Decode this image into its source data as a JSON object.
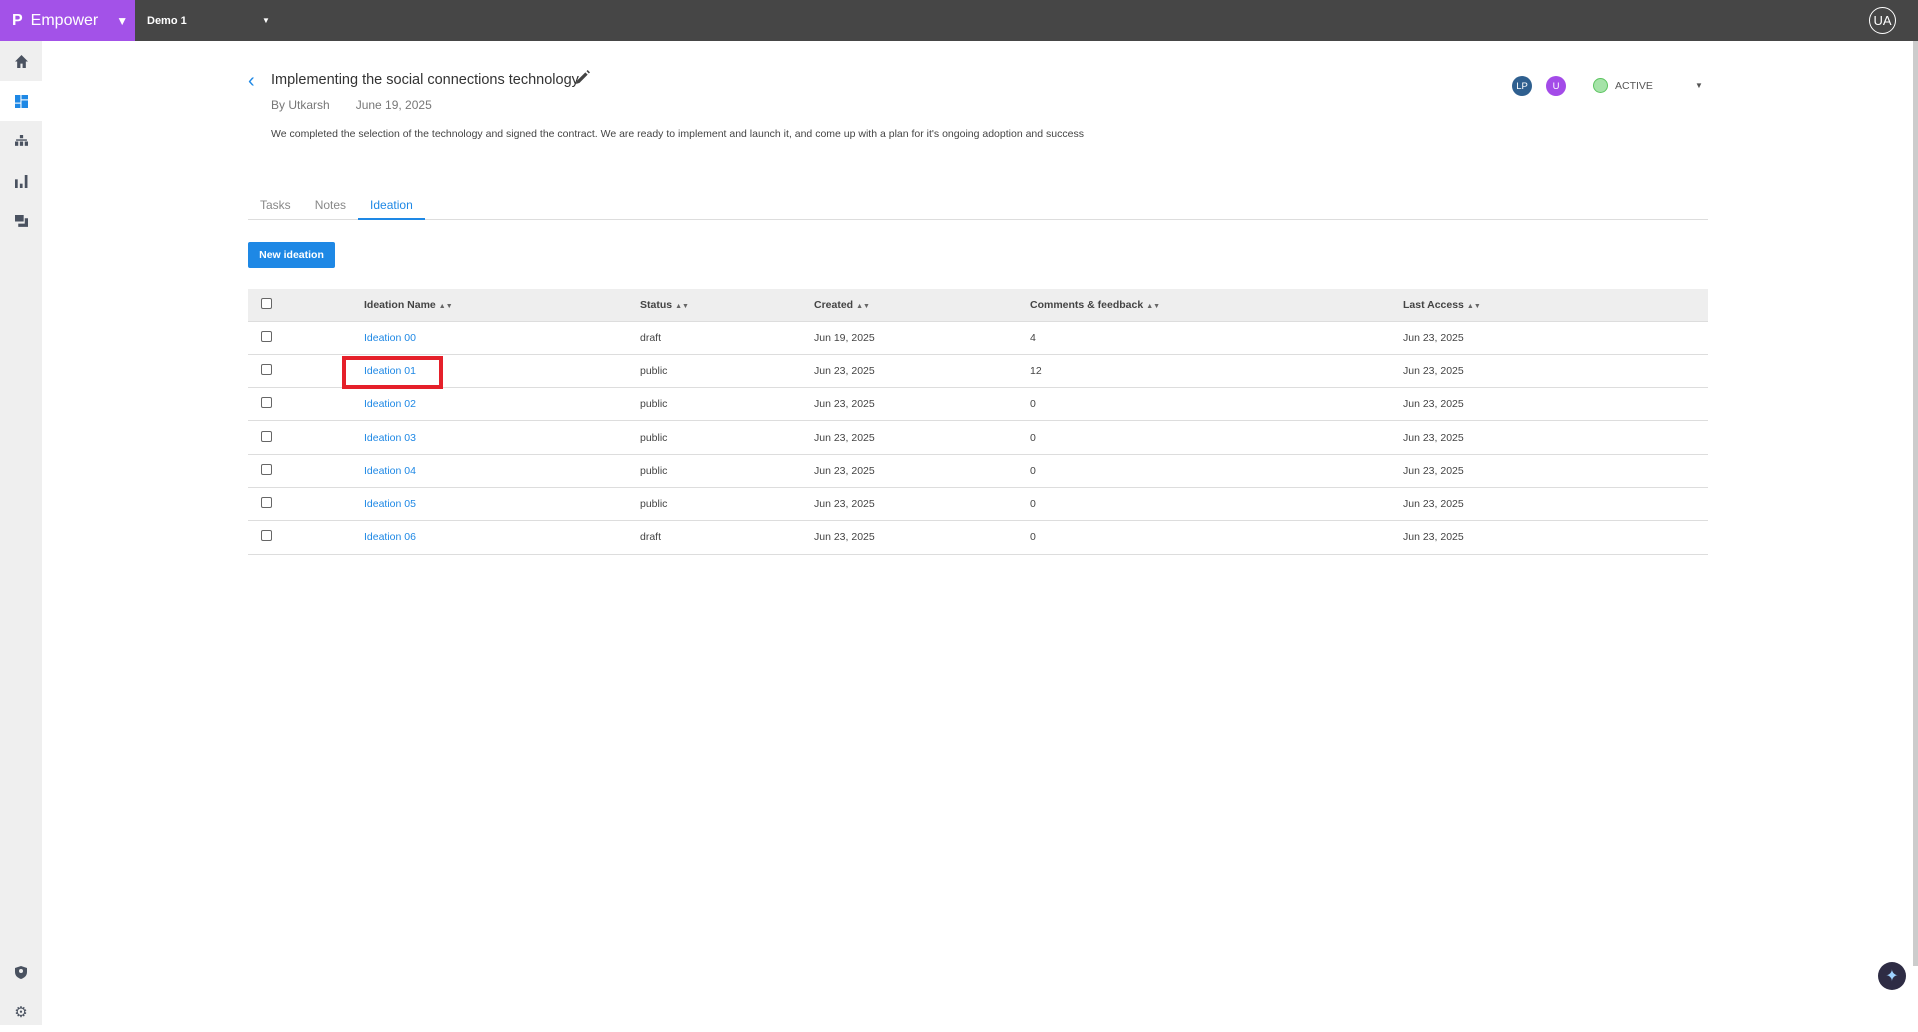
{
  "app": {
    "brand": "Empower",
    "workspace": "Demo 1",
    "user_initials": "UA"
  },
  "sidebar": {
    "items": [
      {
        "icon": "home-icon"
      },
      {
        "icon": "dashboard-icon",
        "active": true
      },
      {
        "icon": "hierarchy-icon"
      },
      {
        "icon": "bar-chart-icon"
      },
      {
        "icon": "chat-icon"
      },
      {
        "icon": "user-shield-icon"
      },
      {
        "icon": "gear-icon"
      }
    ]
  },
  "project": {
    "title": "Implementing the social connections technology",
    "author": "By Utkarsh",
    "date": "June 19, 2025",
    "description": "We completed the selection of the technology and signed the contract. We are ready to implement and launch it, and come up with a plan for it's ongoing adoption and success",
    "members": [
      {
        "initials": "LP",
        "color": "#2e5f8f"
      },
      {
        "initials": "U",
        "color": "#a34be8"
      }
    ],
    "status": "ACTIVE",
    "status_color": "#a5e3a8"
  },
  "tabs": [
    {
      "label": "Tasks"
    },
    {
      "label": "Notes"
    },
    {
      "label": "Ideation",
      "active": true
    }
  ],
  "new_button": "New ideation",
  "table": {
    "headers": [
      "Ideation Name",
      "Status",
      "Created",
      "Comments & feedback",
      "Last Access"
    ],
    "rows": [
      [
        "Ideation 00",
        "draft",
        "Jun 19, 2025",
        "4",
        "Jun 23, 2025"
      ],
      [
        "Ideation 01",
        "public",
        "Jun 23, 2025",
        "12",
        "Jun 23, 2025"
      ],
      [
        "Ideation 02",
        "public",
        "Jun 23, 2025",
        "0",
        "Jun 23, 2025"
      ],
      [
        "Ideation 03",
        "public",
        "Jun 23, 2025",
        "0",
        "Jun 23, 2025"
      ],
      [
        "Ideation 04",
        "public",
        "Jun 23, 2025",
        "0",
        "Jun 23, 2025"
      ],
      [
        "Ideation 05",
        "public",
        "Jun 23, 2025",
        "0",
        "Jun 23, 2025"
      ],
      [
        "Ideation 06",
        "draft",
        "Jun 23, 2025",
        "0",
        "Jun 23, 2025"
      ]
    ]
  },
  "highlight": {
    "target": "Ideation 01",
    "color": "#e5202a"
  },
  "colors": {
    "accent": "#1e88e5",
    "brand": "#a352e8",
    "topbar": "#464646"
  }
}
